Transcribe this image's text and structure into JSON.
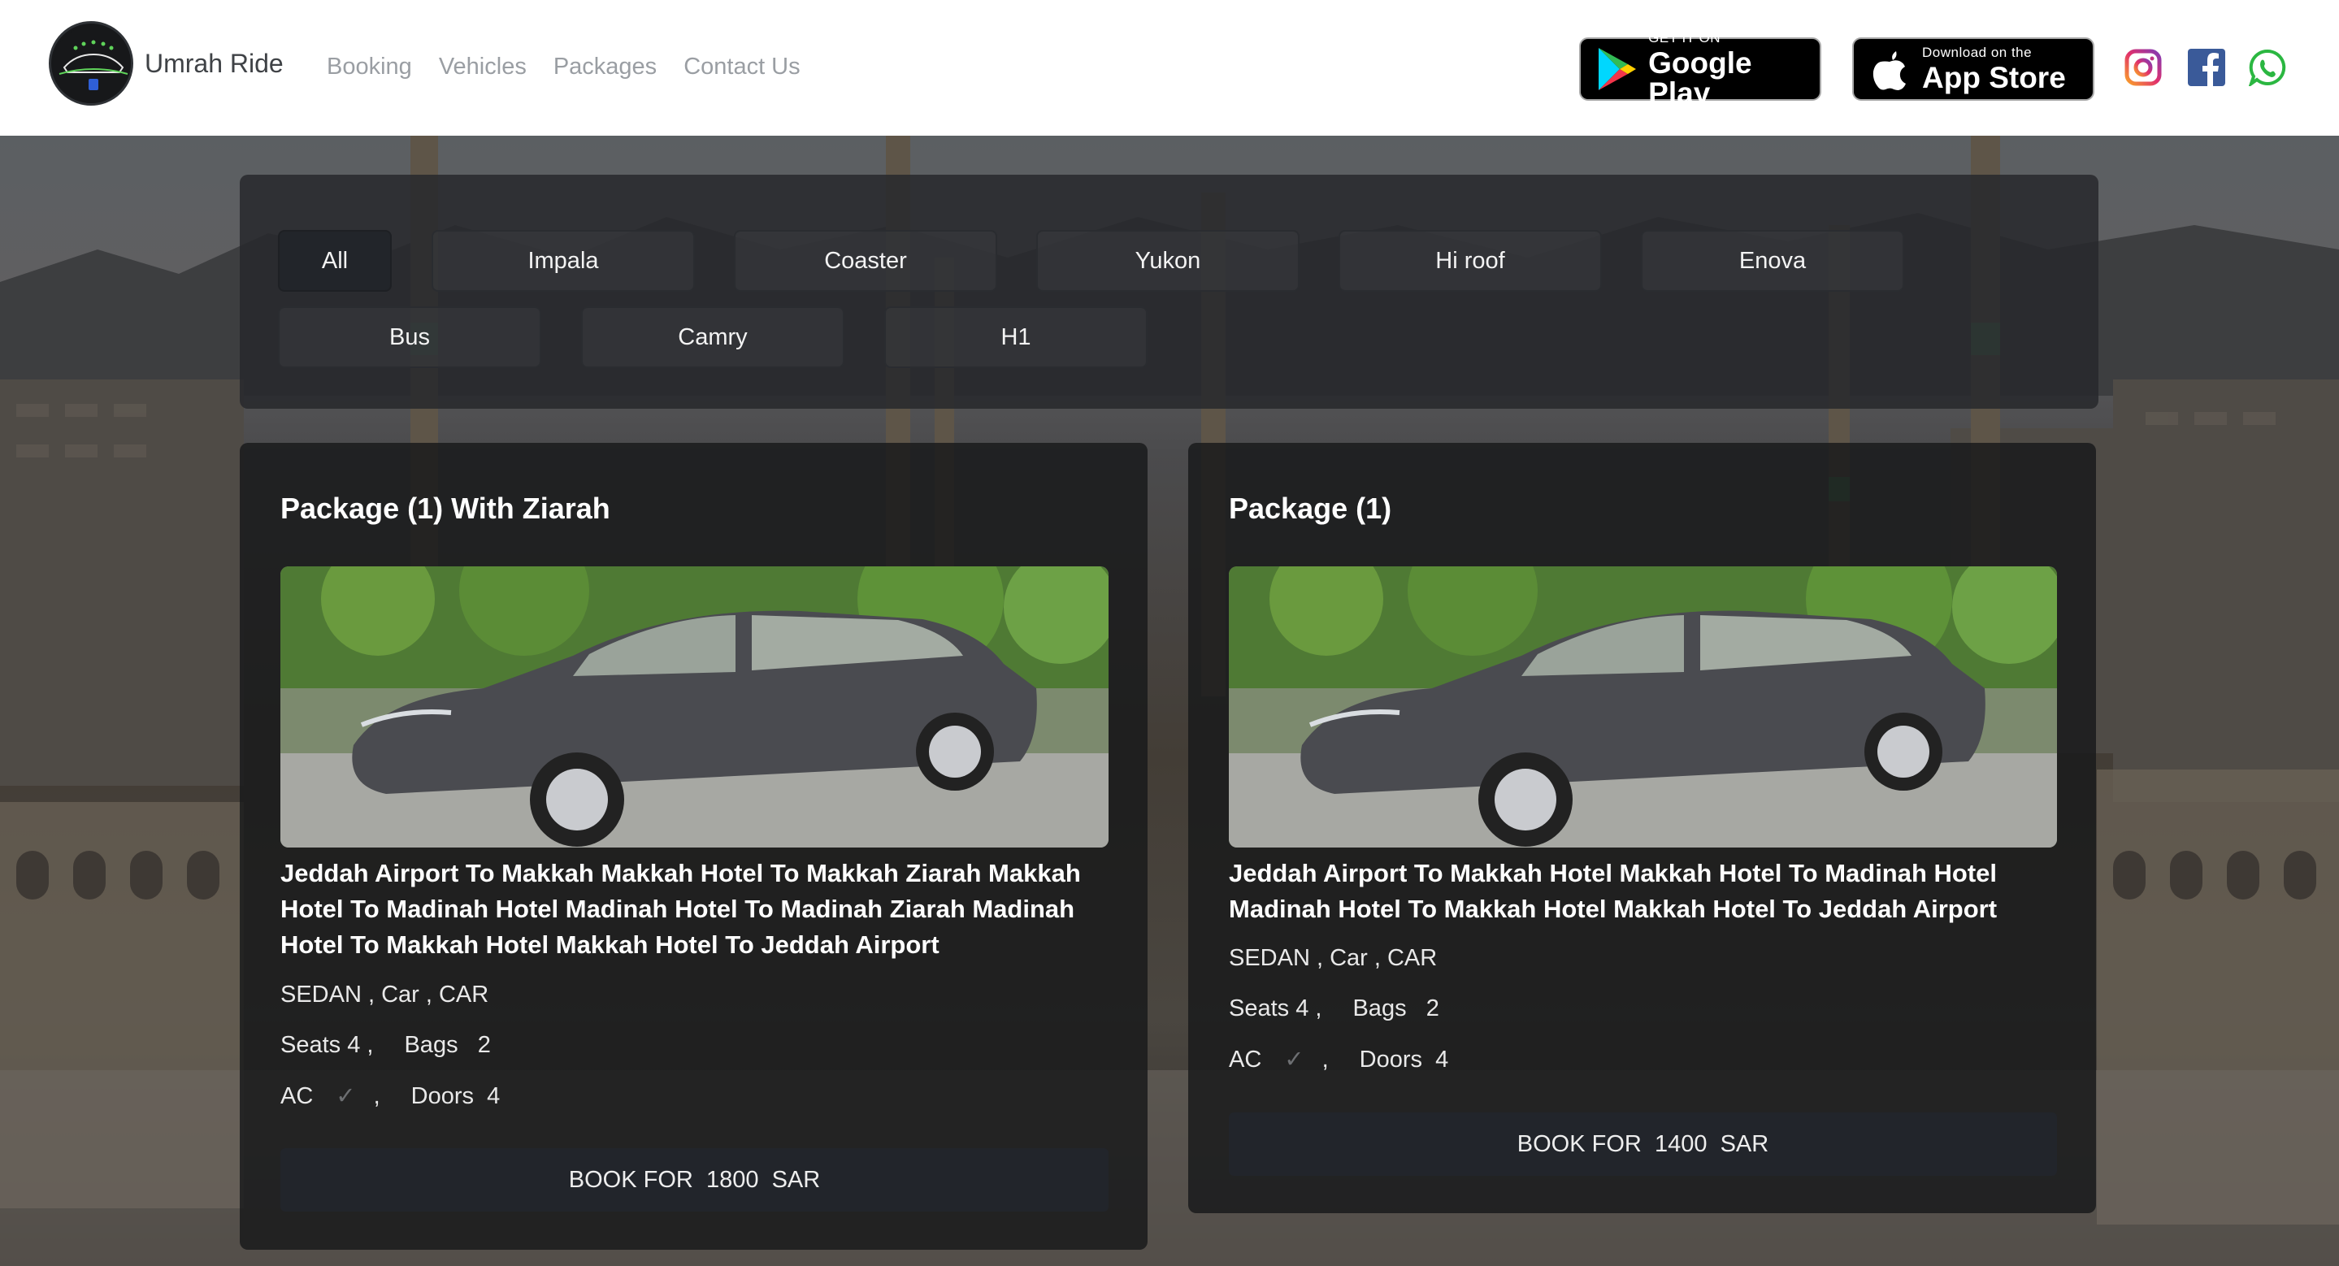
{
  "brand": {
    "name": "Umrah Ride",
    "logo_text": "UMRAH RIDE"
  },
  "nav": [
    "Booking",
    "Vehicles",
    "Packages",
    "Contact Us"
  ],
  "stores": {
    "google": {
      "small": "GET IT ON",
      "big": "Google Play"
    },
    "apple": {
      "small": "Download on the",
      "big": "App Store"
    }
  },
  "social": [
    "instagram-icon",
    "facebook-icon",
    "whatsapp-icon"
  ],
  "filters": [
    "All",
    "Impala",
    "Coaster",
    "Yukon",
    "Hi roof",
    "Enova",
    "Bus",
    "Camry",
    "H1"
  ],
  "active_filter": "All",
  "packages": [
    {
      "title": "Package (1) With Ziarah",
      "route": "Jeddah Airport To Makkah Makkah Hotel To Makkah Ziarah Makkah Hotel To Madinah Hotel Madinah Hotel To Madinah Ziarah Madinah Hotel To Makkah Hotel Makkah Hotel To Jeddah Airport",
      "type": "SEDAN , Car , CAR",
      "seats_label": "Seats 4 ,",
      "bags_label": "Bags",
      "bags": "2",
      "ac_label": "AC",
      "ac_check": "✓",
      "doors_label": "Doors",
      "doors": "4",
      "book": "BOOK FOR  1800  SAR"
    },
    {
      "title": "Package (1)",
      "route": "Jeddah Airport To Makkah Hotel Makkah Hotel To Madinah Hotel Madinah Hotel To Makkah Hotel Makkah Hotel To Jeddah Airport",
      "type": "SEDAN , Car , CAR",
      "seats_label": "Seats 4 ,",
      "bags_label": "Bags",
      "bags": "2",
      "ac_label": "AC",
      "ac_check": "✓",
      "doors_label": "Doors",
      "doors": "4",
      "book": "BOOK FOR  1400  SAR"
    }
  ],
  "colors": {
    "header_bg": "#ffffff",
    "panel_bg": "#28292c",
    "button_bg": "#22252b",
    "car": "#4a4b50"
  }
}
